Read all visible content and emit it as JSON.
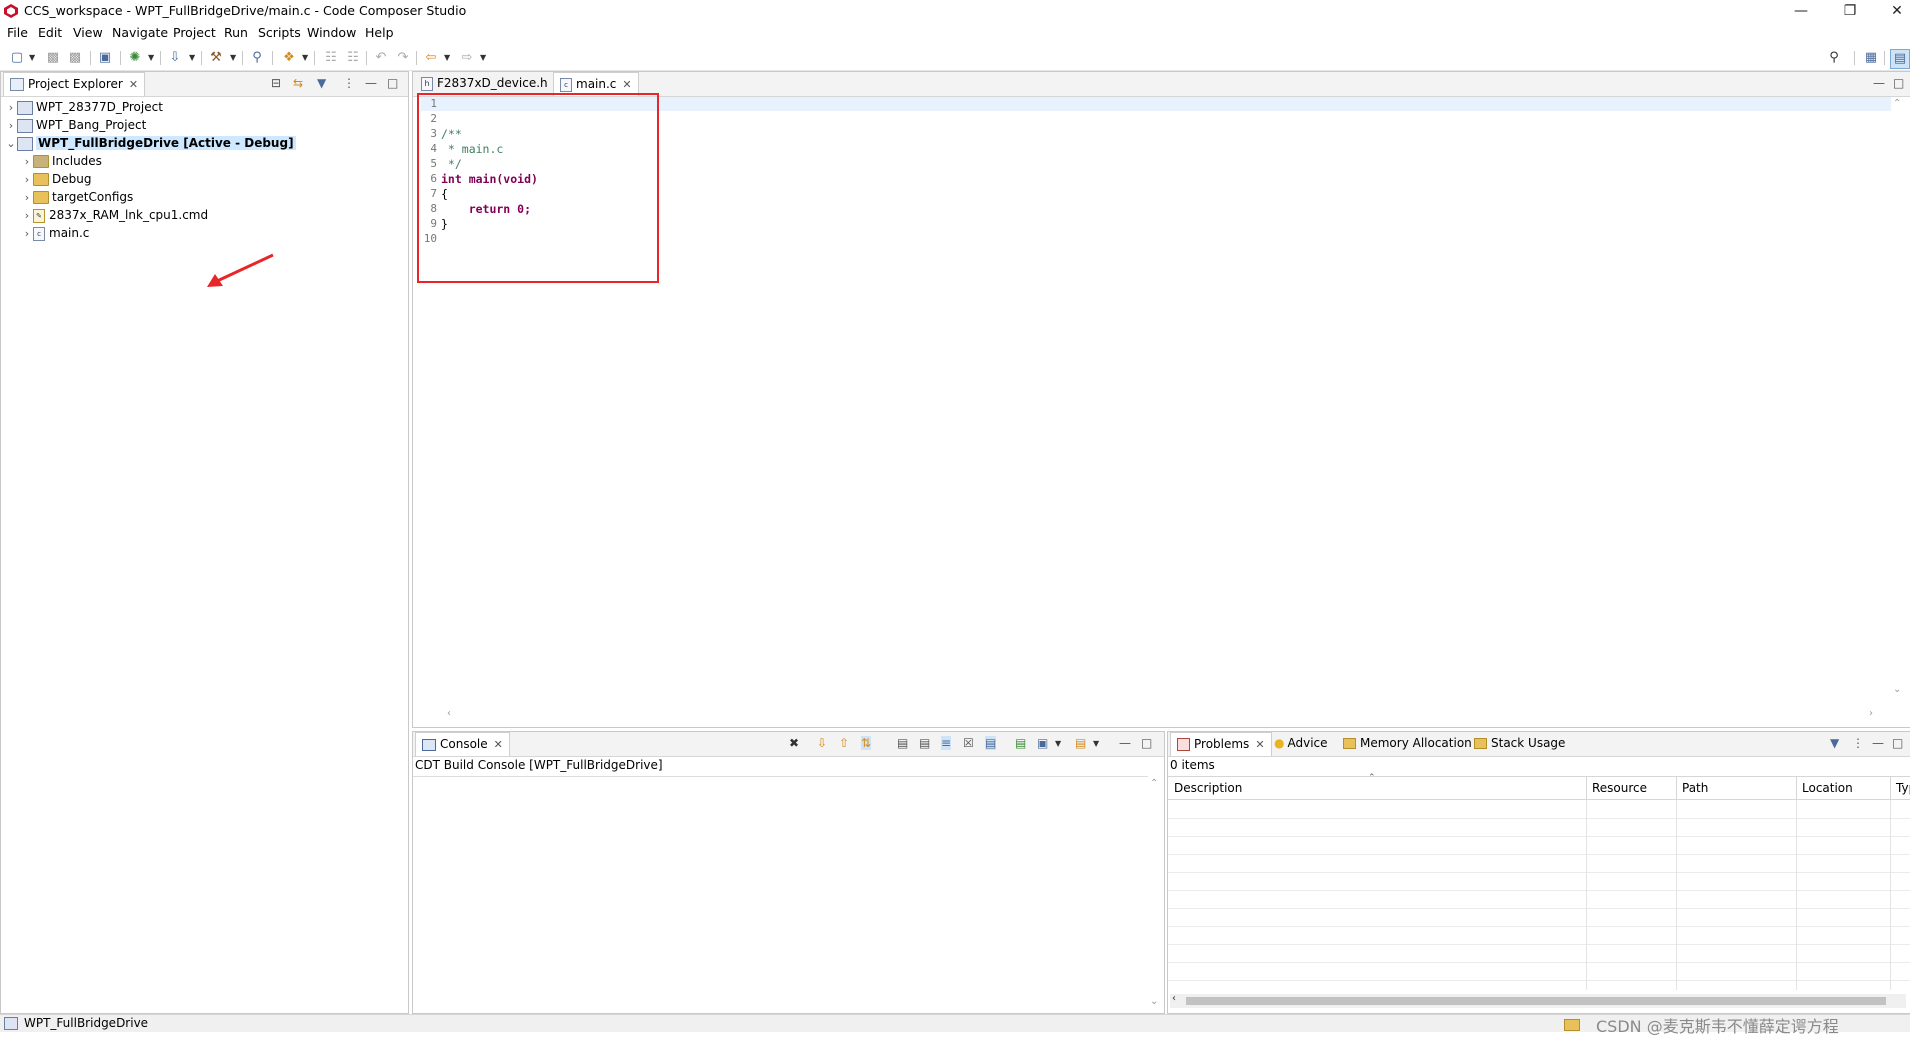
{
  "window": {
    "title": "CCS_workspace - WPT_FullBridgeDrive/main.c - Code Composer Studio"
  },
  "menu": [
    "File",
    "Edit",
    "View",
    "Navigate",
    "Project",
    "Run",
    "Scripts",
    "Window",
    "Help"
  ],
  "project_explorer": {
    "tab_label": "Project Explorer",
    "items": [
      {
        "label": "WPT_28377D_Project",
        "level": 0,
        "expanded": false,
        "type": "project"
      },
      {
        "label": "WPT_Bang_Project",
        "level": 0,
        "expanded": false,
        "type": "project"
      },
      {
        "label": "WPT_FullBridgeDrive  [Active - Debug]",
        "level": 0,
        "expanded": true,
        "type": "project",
        "selected": true
      },
      {
        "label": "Includes",
        "level": 1,
        "expanded": false,
        "type": "includes"
      },
      {
        "label": "Debug",
        "level": 1,
        "expanded": false,
        "type": "folder"
      },
      {
        "label": "targetConfigs",
        "level": 1,
        "expanded": false,
        "type": "folder"
      },
      {
        "label": "2837x_RAM_lnk_cpu1.cmd",
        "level": 1,
        "expanded": false,
        "type": "cmd"
      },
      {
        "label": "main.c",
        "level": 1,
        "expanded": false,
        "type": "c"
      }
    ]
  },
  "editor": {
    "tabs": [
      {
        "label": "F2837xD_device.h",
        "icon": "h",
        "active": false
      },
      {
        "label": "main.c",
        "icon": "c",
        "active": true
      }
    ],
    "line_numbers": [
      "1",
      "2",
      "3",
      "4",
      "5",
      "6",
      "7",
      "8",
      "9",
      "10"
    ],
    "lines": [
      "",
      "",
      "/**",
      " * main.c",
      " */",
      "int main(void)",
      "{",
      "    return 0;",
      "}",
      ""
    ]
  },
  "console": {
    "tab_label": "Console",
    "header": "CDT Build Console [WPT_FullBridgeDrive]"
  },
  "problems": {
    "tabs": [
      "Problems",
      "Advice",
      "Memory Allocation",
      "Stack Usage"
    ],
    "count_text": "0 items",
    "columns": [
      "Description",
      "Resource",
      "Path",
      "Location",
      "Type"
    ]
  },
  "status_bar": {
    "text": "WPT_FullBridgeDrive",
    "watermark": "CSDN @麦克斯韦不懂薛定谔方程"
  },
  "colors": {
    "highlight_box": "#e8262a",
    "arrow": "#e8262a",
    "selected_row": "#cde8ff"
  }
}
